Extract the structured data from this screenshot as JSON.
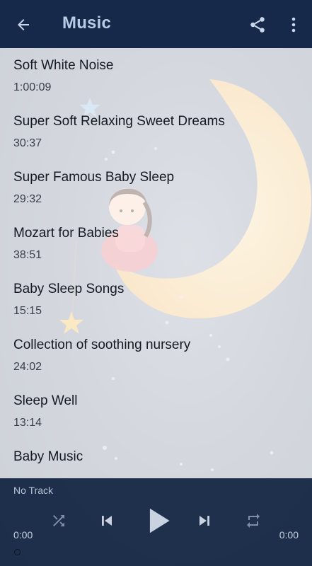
{
  "app_bar": {
    "title": "Music",
    "back_icon": "arrow-left-icon",
    "share_icon": "share-icon",
    "more_icon": "more-vertical-icon",
    "background": "#16294a"
  },
  "tracks": [
    {
      "name": "Soft White Noise",
      "duration": "1:00:09"
    },
    {
      "name": "Super Soft Relaxing Sweet Dreams",
      "duration": "30:37"
    },
    {
      "name": "Super Famous Baby Sleep",
      "duration": "29:32"
    },
    {
      "name": "Mozart for Babies",
      "duration": "38:51"
    },
    {
      "name": "Baby Sleep Songs",
      "duration": "15:15"
    },
    {
      "name": "Collection of soothing nursery",
      "duration": "24:02"
    },
    {
      "name": "Sleep Well",
      "duration": "13:14"
    },
    {
      "name": "Baby Music",
      "duration": ""
    }
  ],
  "player": {
    "now_playing": "No Track",
    "elapsed": "0:00",
    "total": "0:00",
    "progress": 0,
    "controls": [
      "shuffle-icon",
      "skip-previous-icon",
      "play-icon",
      "skip-next-icon",
      "repeat-icon"
    ]
  }
}
